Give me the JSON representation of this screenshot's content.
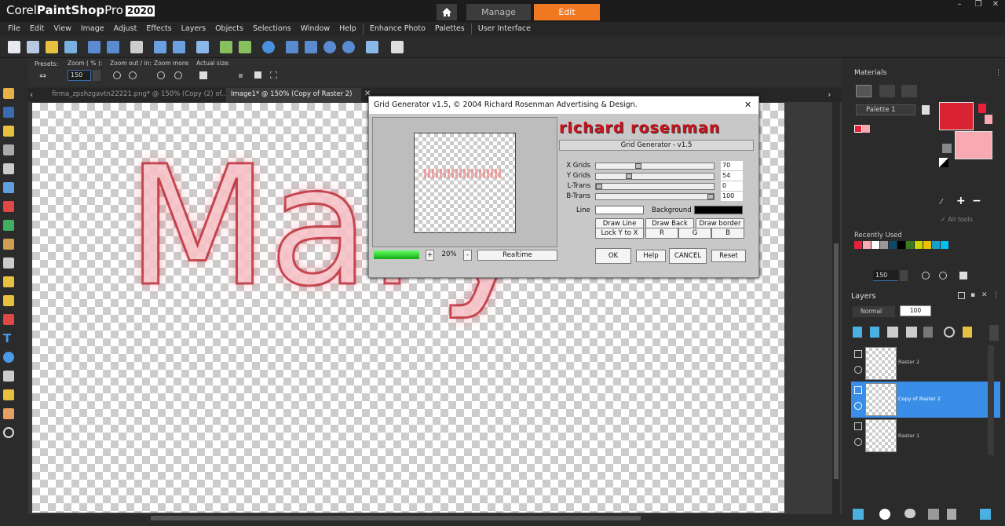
{
  "app": {
    "brand_corel": "Corel",
    "brand_name": "PaintShop",
    "brand_pro": "Pro",
    "brand_year": "2020"
  },
  "workspace_tabs": {
    "manage": "Manage",
    "edit": "Edit"
  },
  "menu": [
    "File",
    "Edit",
    "View",
    "Image",
    "Adjust",
    "Effects",
    "Layers",
    "Objects",
    "Selections",
    "Window",
    "Help",
    "Enhance Photo",
    "Palettes",
    "User Interface"
  ],
  "options": {
    "presets": "Presets:",
    "zoom_label": "Zoom ( % ):",
    "zoom_value": "150",
    "zoom_outin": "Zoom out / in:",
    "zoom_more": "Zoom more:",
    "actual": "Actual size:"
  },
  "doc_tabs": [
    "firma_zpshzgavtn22221.png* @ 150% (Copy (2) of...",
    "Image1* @ 150% (Copy of Raster 2)"
  ],
  "canvas": {
    "text": "Mary"
  },
  "dialog": {
    "title": "Grid Generator v1.5, © 2004 Richard Rosenman Advertising & Design.",
    "logo": "richard rosenman",
    "subtitle": "Grid Generator - v1.5",
    "sliders": [
      {
        "label": "X Grids",
        "value": "70",
        "level": 0.35
      },
      {
        "label": "Y Grids",
        "value": "54",
        "level": 0.27
      },
      {
        "label": "L-Trans",
        "value": "0",
        "level": 0.0
      },
      {
        "label": "B-Trans",
        "value": "100",
        "level": 1.0
      }
    ],
    "line_label": "Line",
    "background_label": "Background",
    "draw_line": "Draw Line",
    "draw_back": "Draw Back",
    "draw_border": "Draw border",
    "lock": "Lock Y to X",
    "r": "R",
    "g": "G",
    "b": "B",
    "zoom_plus": "+",
    "zoom_value": "20%",
    "zoom_minus": "-",
    "realtime": "Realtime",
    "ok": "OK",
    "help": "Help",
    "cancel": "CANCEL",
    "reset": "Reset"
  },
  "materials": {
    "title": "Materials",
    "palette": "Palette 1",
    "alltools": "All tools",
    "recently_used": "Recently Used",
    "zoom": "150",
    "fg_color": "#d92232",
    "bg_color": "#f7aab2",
    "recent_colors": [
      "#e8203a",
      "#f7aab2",
      "#ffffff",
      "#999999",
      "#0c4a66",
      "#000000",
      "#3a7a20",
      "#c8d800",
      "#f0c000",
      "#1aa0c8",
      "#00c0f0"
    ]
  },
  "layers": {
    "title": "Layers",
    "blend": "Normal",
    "opacity": "100",
    "items": [
      {
        "name": "Raster 2",
        "selected": false
      },
      {
        "name": "Copy of Raster 2",
        "selected": true
      },
      {
        "name": "Raster 1",
        "selected": false
      }
    ]
  }
}
